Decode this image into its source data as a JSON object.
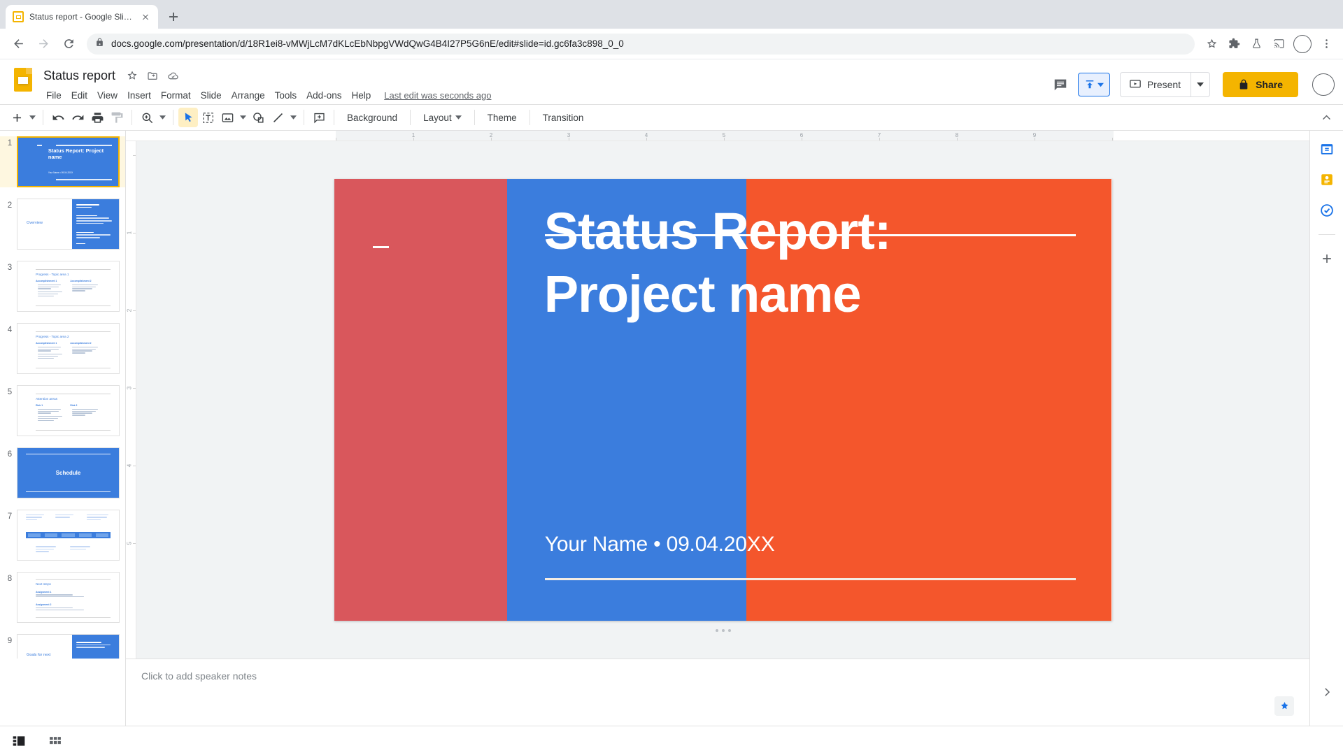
{
  "browser": {
    "tab": {
      "title": "Status report - Google Slides",
      "favicon": "slides-favicon"
    },
    "newtab_label": "+",
    "url": "docs.google.com/presentation/d/18R1ei8-vMWjLcM7dKLcEbNbpgVWdQwG4B4I27P5G6nE/edit#slide=id.gc6fa3c898_0_0",
    "nav": {
      "back": "back-arrow",
      "forward": "forward-arrow",
      "reload": "reload"
    },
    "omni_icons": [
      "bookmark-star",
      "extensions-puzzle",
      "labs-flask",
      "cast-screen",
      "profile-avatar",
      "chrome-menu"
    ]
  },
  "app": {
    "doc_title": "Status report",
    "title_icons": [
      "star",
      "move-to-folder",
      "cloud-saved"
    ],
    "menus": [
      "File",
      "Edit",
      "View",
      "Insert",
      "Format",
      "Slide",
      "Arrange",
      "Tools",
      "Add-ons",
      "Help"
    ],
    "last_edit": "Last edit was seconds ago",
    "header_right": {
      "comment_history": "comment-history",
      "edit_mode": "edit-mode",
      "present_label": "Present",
      "share_label": "Share"
    },
    "toolbar": {
      "new_slide": "new-slide",
      "undo": "undo",
      "redo": "redo",
      "print": "print",
      "paint_format": "paint-format",
      "zoom": "zoom",
      "select": "select-cursor",
      "textbox": "text-box",
      "image": "insert-image",
      "shape": "insert-shape",
      "line": "insert-line",
      "comment": "add-comment",
      "buttons": [
        "Background",
        "Layout",
        "Theme",
        "Transition"
      ],
      "collapse": "collapse-toolbar"
    }
  },
  "filmstrip": {
    "selected_index": 1,
    "slides": [
      {
        "n": "1",
        "kind": "title",
        "title": "Status Report:\nProject name",
        "byline": "Your Name • 09.04.20XX"
      },
      {
        "n": "2",
        "kind": "section",
        "label": "Overview"
      },
      {
        "n": "3",
        "kind": "content",
        "heading": "Progress - Topic area 1",
        "col1": "Accomplishment 1",
        "col2": "Accomplishment 2"
      },
      {
        "n": "4",
        "kind": "content",
        "heading": "Progress - Topic area 2",
        "col1": "Accomplishment 1",
        "col2": "Accomplishment 2"
      },
      {
        "n": "5",
        "kind": "content",
        "heading": "Attention areas",
        "col1": "Risk 1",
        "col2": "Risk 2"
      },
      {
        "n": "6",
        "kind": "divider",
        "label": "Schedule"
      },
      {
        "n": "7",
        "kind": "timeline"
      },
      {
        "n": "8",
        "kind": "content",
        "heading": "Next steps",
        "col1": "Assignment 1",
        "col2": "Assignment 2"
      },
      {
        "n": "9",
        "kind": "section",
        "label": "Goals for next"
      }
    ]
  },
  "canvas": {
    "rulers": {
      "h_labels": [
        "1",
        "2",
        "3",
        "4",
        "5",
        "6",
        "7",
        "8",
        "9"
      ],
      "v_labels": [
        "1",
        "2",
        "3",
        "4",
        "5"
      ]
    },
    "slide": {
      "title_line1": "Status Report:",
      "title_line2": "Project name",
      "byline": "Your Name • 09.04.20XX",
      "bands": [
        {
          "name": "band-red",
          "color": "#d9575c",
          "left_pct": 0,
          "width_pct": 22.3
        },
        {
          "name": "band-blue",
          "color": "#3b7ddd",
          "left_pct": 22.3,
          "width_pct": 30.7
        },
        {
          "name": "band-orange",
          "color": "#f4562c",
          "left_pct": 53.0,
          "width_pct": 47.0
        }
      ],
      "rules": {
        "top": "white-rule-top",
        "bottom": "white-rule-bottom",
        "accent": "white-dash-accent"
      }
    }
  },
  "notes": {
    "placeholder": "Click to add speaker notes",
    "explore_icon": "explore-fab",
    "expand_icon": "expand-panel"
  },
  "rightrail": {
    "icons": [
      "calendar-sidebar",
      "keep-sidebar",
      "tasks-sidebar",
      "add-sidebar-app"
    ]
  },
  "bottombar": {
    "filmstrip_view": "filmstrip-view",
    "grid_view": "grid-view"
  },
  "colors": {
    "brand_yellow": "#f4b400",
    "accent_blue": "#1a73e8",
    "slide_red": "#d9575c",
    "slide_blue": "#3b7ddd",
    "slide_orange": "#f4562c"
  }
}
